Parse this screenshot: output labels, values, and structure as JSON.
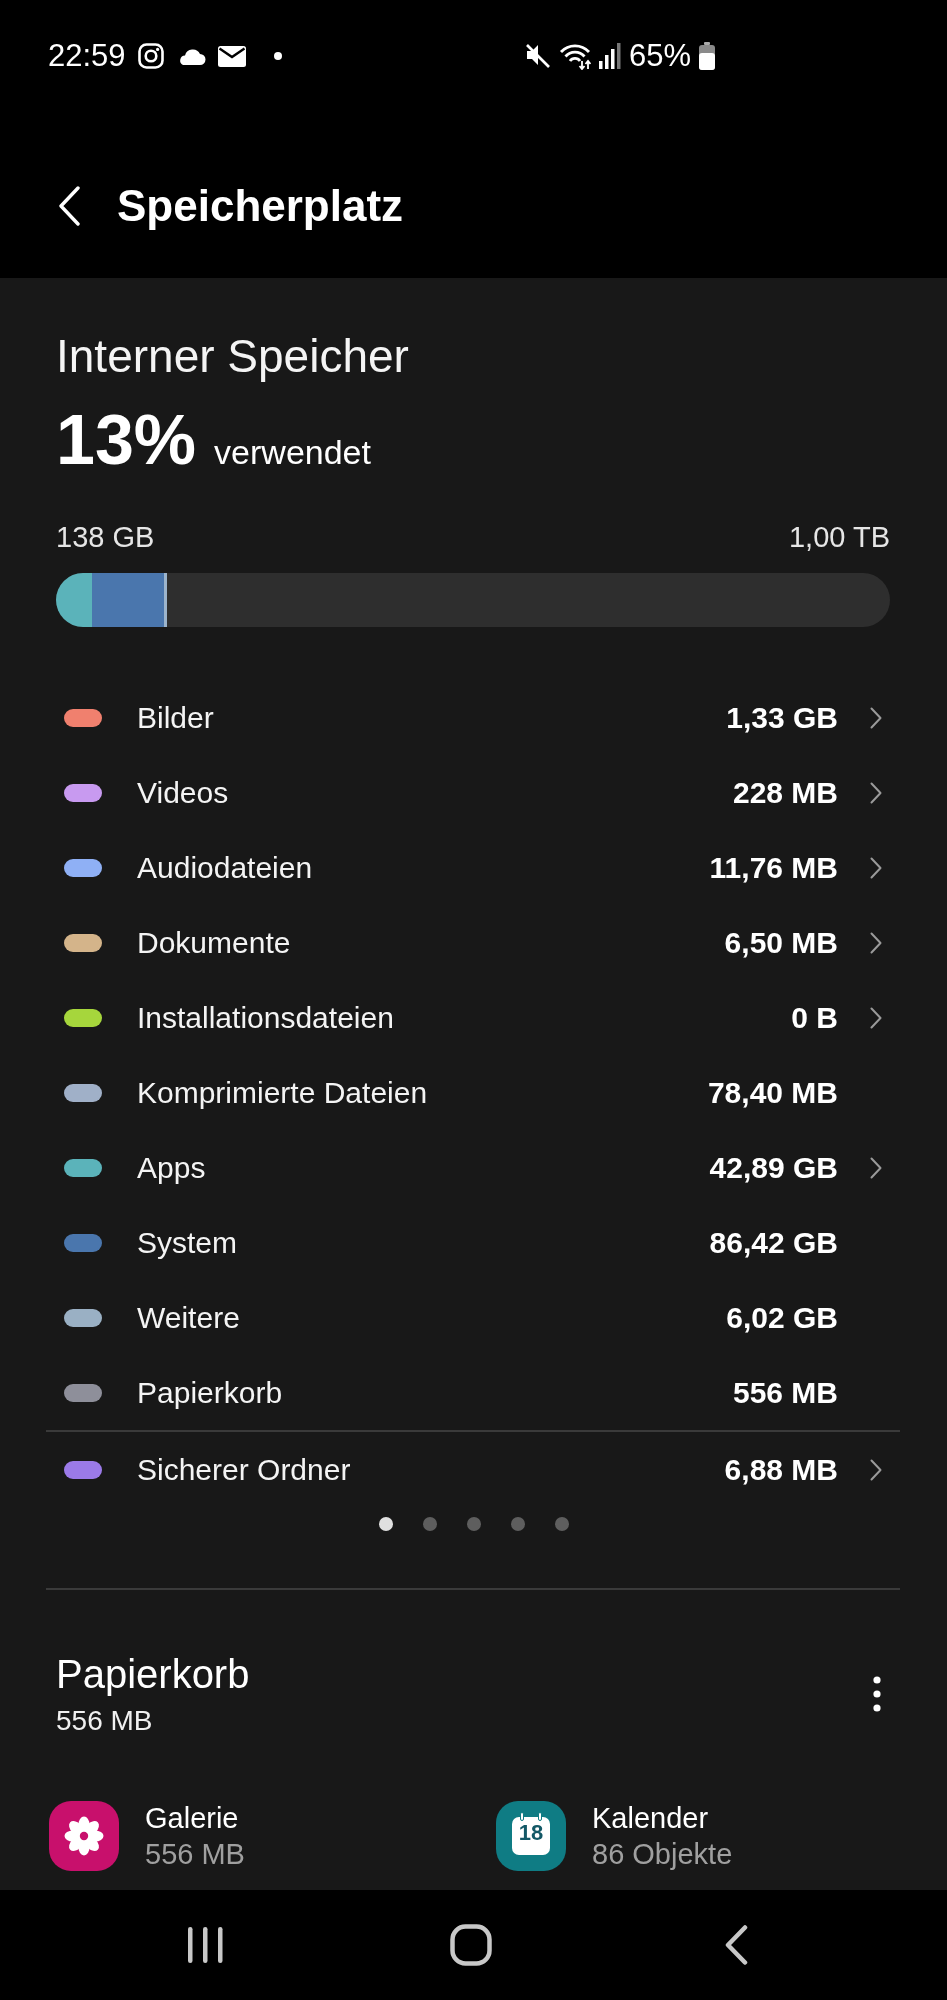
{
  "status_bar": {
    "time": "22:59",
    "battery_text": "65%"
  },
  "header": {
    "title": "Speicherplatz"
  },
  "storage": {
    "title": "Interner Speicher",
    "percent": "13%",
    "percent_label": "verwendet",
    "used": "138 GB",
    "total": "1,00 TB",
    "bar_segments": [
      {
        "color": "#5bb3ba",
        "level": 0.043
      },
      {
        "color": "#4a76ad",
        "level": 0.086
      },
      {
        "color": "#9cb4cc",
        "level": 0.004
      }
    ]
  },
  "categories": [
    {
      "name": "Bilder",
      "size": "1,33 GB",
      "color": "#f0806e",
      "chevron": true
    },
    {
      "name": "Videos",
      "size": "228 MB",
      "color": "#c89af0",
      "chevron": true
    },
    {
      "name": "Audiodateien",
      "size": "11,76 MB",
      "color": "#8fb0f5",
      "chevron": true
    },
    {
      "name": "Dokumente",
      "size": "6,50 MB",
      "color": "#d4b48a",
      "chevron": true
    },
    {
      "name": "Installationsdateien",
      "size": "0 B",
      "color": "#a6d63c",
      "chevron": true
    },
    {
      "name": "Komprimierte Dateien",
      "size": "78,40 MB",
      "color": "#a0b0c8",
      "chevron": false
    },
    {
      "name": "Apps",
      "size": "42,89 GB",
      "color": "#5bb3ba",
      "chevron": true
    },
    {
      "name": "System",
      "size": "86,42 GB",
      "color": "#4a76ad",
      "chevron": false
    },
    {
      "name": "Weitere",
      "size": "6,02 GB",
      "color": "#9ab0c4",
      "chevron": false
    },
    {
      "name": "Papierkorb",
      "size": "556 MB",
      "color": "#8e8f9a",
      "chevron": false
    }
  ],
  "secure_folder": {
    "name": "Sicherer Ordner",
    "size": "6,88 MB",
    "color": "#9b7ae8",
    "chevron": true
  },
  "pages": [
    {
      "selected": true
    },
    {
      "selected": false
    },
    {
      "selected": false
    },
    {
      "selected": false
    },
    {
      "selected": false
    }
  ],
  "trash": {
    "title": "Papierkorb",
    "size": "556 MB",
    "apps": [
      {
        "kind": "gallery",
        "name": "Galerie",
        "detail": "556 MB"
      },
      {
        "kind": "calendar",
        "name": "Kalender",
        "detail": "86 Objekte",
        "icon_label": "18"
      }
    ]
  }
}
